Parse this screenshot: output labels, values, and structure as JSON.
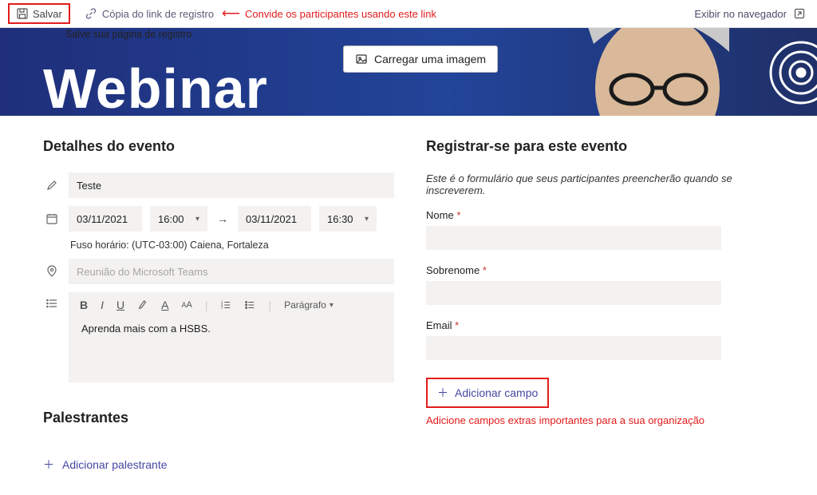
{
  "topbar": {
    "save_label": "Salvar",
    "copy_link_label": "Cópia do link de registro",
    "invite_annotation": "Convide os participantes usando este link",
    "view_browser_label": "Exibir no navegador",
    "save_caption": "Salve sua página de registro"
  },
  "banner": {
    "title": "Webinar",
    "upload_label": "Carregar uma imagem"
  },
  "details": {
    "heading": "Detalhes do evento",
    "title_value": "Teste",
    "start_date": "03/11/2021",
    "start_time": "16:00",
    "end_date": "03/11/2021",
    "end_time": "16:30",
    "timezone": "Fuso horário: (UTC-03:00) Caiena, Fortaleza",
    "location_placeholder": "Reunião do Microsoft Teams",
    "rte": {
      "paragraph_label": "Parágrafo",
      "body": "Aprenda mais com a HSBS."
    }
  },
  "speakers": {
    "heading": "Palestrantes",
    "add_label": "Adicionar palestrante"
  },
  "register": {
    "heading": "Registrar-se para este evento",
    "intro": "Este é o formulário que seus participantes preencherão quando se inscreverem.",
    "fields": {
      "name_label": "Nome",
      "surname_label": "Sobrenome",
      "email_label": "Email"
    },
    "add_field_label": "Adicionar campo",
    "add_field_caption": "Adicione campos extras importantes para a sua organização"
  }
}
